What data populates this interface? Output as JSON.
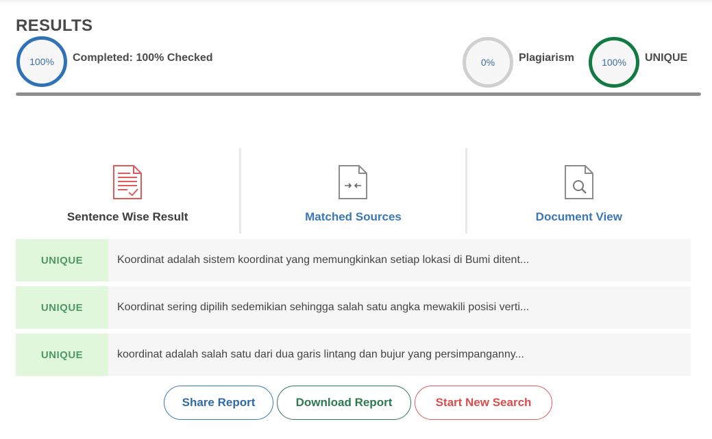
{
  "header": {
    "title": "RESULTS",
    "completed_ring": "100%",
    "completed_label": "Completed: 100% Checked",
    "completed_progress_percent": 100,
    "plagiarism_ring": "0%",
    "plagiarism_label": "Plagiarism",
    "unique_ring": "100%",
    "unique_label": "UNIQUE"
  },
  "tabs": [
    {
      "label": "Sentence Wise Result",
      "icon": "document-check-icon",
      "active": true
    },
    {
      "label": "Matched Sources",
      "icon": "document-compare-icon",
      "active": false
    },
    {
      "label": "Document View",
      "icon": "document-search-icon",
      "active": false
    }
  ],
  "results": [
    {
      "badge": "UNIQUE",
      "text": "Koordinat adalah sistem koordinat yang memungkinkan setiap lokasi di Bumi ditent..."
    },
    {
      "badge": "UNIQUE",
      "text": "Koordinat sering dipilih sedemikian sehingga salah satu angka mewakili posisi verti..."
    },
    {
      "badge": "UNIQUE",
      "text": "koordinat adalah salah satu dari dua garis lintang dan bujur yang persimpanganny..."
    }
  ],
  "actions": {
    "share": "Share Report",
    "download": "Download Report",
    "new_search": "Start New Search"
  },
  "colors": {
    "blue": "#2f72b8",
    "green": "#127a43",
    "red": "#dd4c4c",
    "unique_badge_bg": "#e1f7dc"
  }
}
